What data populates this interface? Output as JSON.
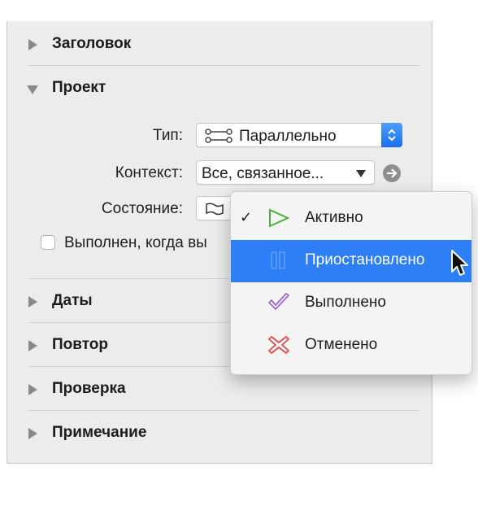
{
  "sections": {
    "title": "Заголовок",
    "project": "Проект",
    "dates": "Даты",
    "repeat": "Повтор",
    "review": "Проверка",
    "note": "Примечание"
  },
  "project": {
    "type_label": "Тип:",
    "type_value": "Параллельно",
    "context_label": "Контекст:",
    "context_value": "Все, связанное...",
    "state_label": "Состояние:",
    "completed_checkbox_label": "Выполнен, когда вы"
  },
  "status_menu": {
    "items": [
      {
        "label": "Активно",
        "checked": true,
        "icon": "play-triangle-icon"
      },
      {
        "label": "Приостановлено",
        "highlighted": true,
        "icon": "pause-icon"
      },
      {
        "label": "Выполнено",
        "icon": "checkmark-icon"
      },
      {
        "label": "Отменено",
        "icon": "cancel-x-icon"
      }
    ]
  },
  "colors": {
    "highlight": "#2e7ff6",
    "active_green": "#4caf3a",
    "done_purple": "#9a6ad6",
    "cancel_red": "#e0474f"
  }
}
